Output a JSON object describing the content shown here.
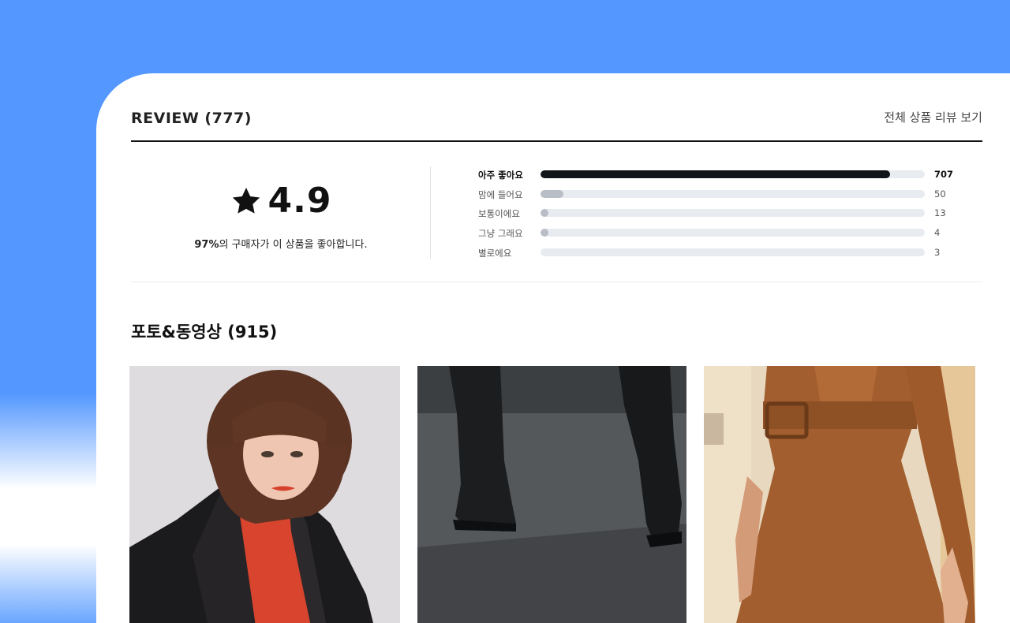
{
  "review": {
    "title": "REVIEW (777)",
    "view_all": "전체 상품 리뷰 보기"
  },
  "summary": {
    "score": "4.9",
    "percent": "97%",
    "percent_suffix": "의 구매자가 이 상품을 좋아합니다."
  },
  "ratings": [
    {
      "label": "아주 좋아요",
      "count": "707",
      "fraction": 0.91
    },
    {
      "label": "맘에 들어요",
      "count": "50",
      "fraction": 0.06
    },
    {
      "label": "보통이에요",
      "count": "13",
      "fraction": 0.02
    },
    {
      "label": "그냥 그래요",
      "count": "4",
      "fraction": 0.02
    },
    {
      "label": "별로에요",
      "count": "3",
      "fraction": 0.0
    }
  ],
  "photos": {
    "title": "포토&동영상 (915)"
  },
  "colors": {
    "background_blue": "#5498ff",
    "bar_top": "#12151a",
    "bar_other": "#b9bec6",
    "track": "#e8ebf0"
  }
}
